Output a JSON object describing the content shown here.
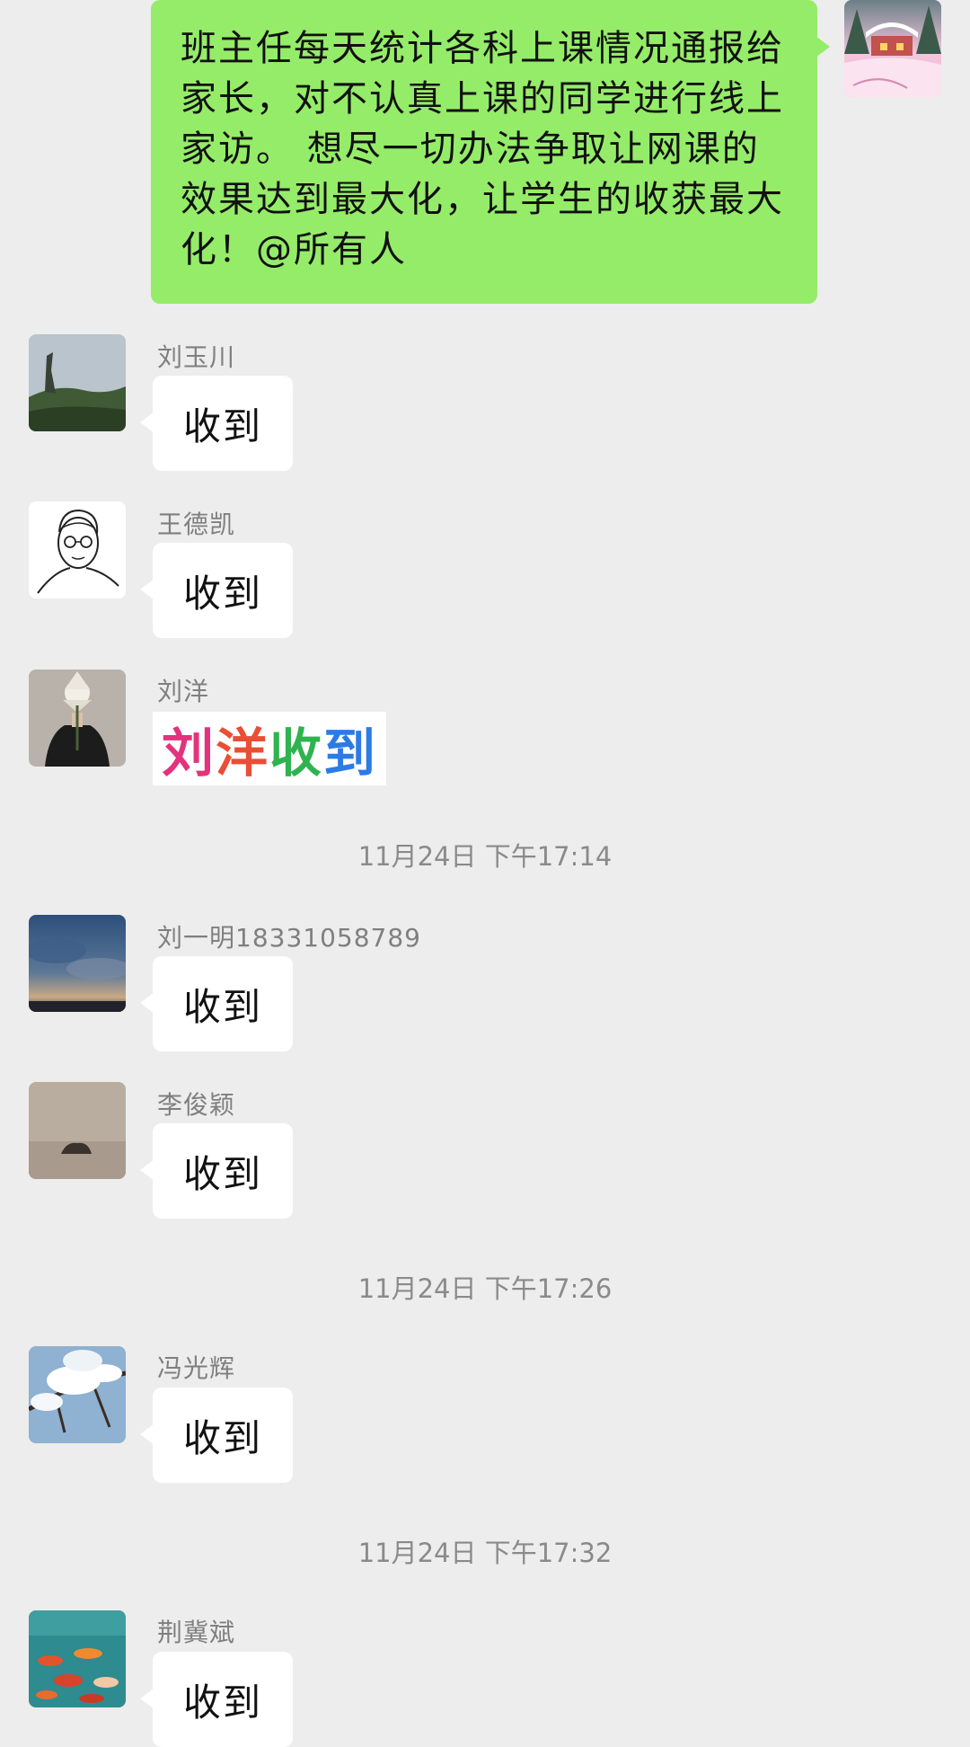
{
  "my_message": {
    "text": "班主任每天统计各科上课情况通报给家长，对不认真上课的同学进行线上家访。 想尽一切办法争取让网课的效果达到最大化，让学生的收获最大化！@所有人"
  },
  "messages": [
    {
      "sender": "刘玉川",
      "text": "收到"
    },
    {
      "sender": "王德凯",
      "text": "收到"
    },
    {
      "sender": "刘洋",
      "sticker_text": "刘洋收到"
    },
    {
      "sender": "刘一明18331058789",
      "text": "收到"
    },
    {
      "sender": "李俊颖",
      "text": "收到"
    },
    {
      "sender": "冯光辉",
      "text": "收到"
    },
    {
      "sender": "荆冀斌",
      "text": "收到"
    }
  ],
  "timestamps": [
    "11月24日 下午17:14",
    "11月24日 下午17:26",
    "11月24日 下午17:32"
  ],
  "colors": {
    "background": "#ededed",
    "my_bubble": "#95ec69",
    "other_bubble": "#ffffff",
    "meta_text": "#8a8a8a"
  }
}
